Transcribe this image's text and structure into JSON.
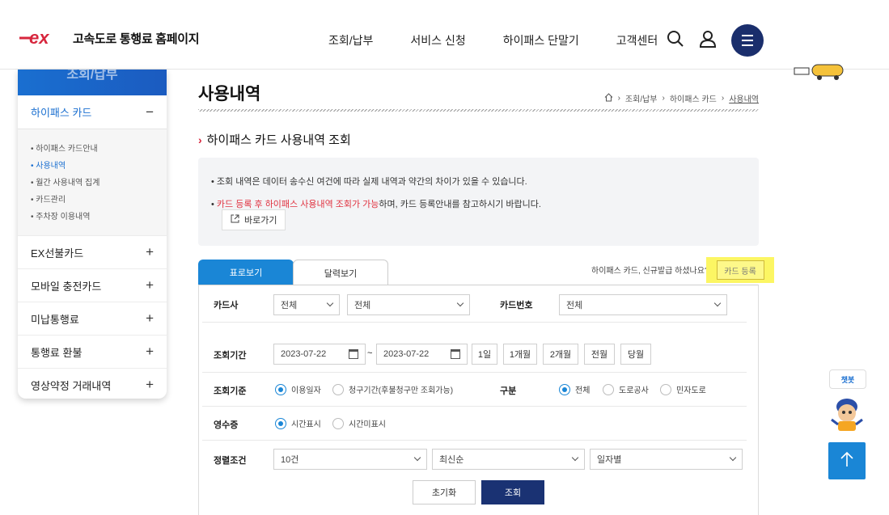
{
  "header": {
    "logo_text": "고속도로 통행료 홈페이지",
    "nav": [
      "조회/납부",
      "서비스 신청",
      "하이패스 단말기",
      "고객센터"
    ]
  },
  "sidebar": {
    "banner": "조회/납부",
    "main": "하이패스 카드",
    "main_toggle": "−",
    "sub": [
      "하이패스 카드안내",
      "사용내역",
      "월간 사용내역 집계",
      "카드관리",
      "주차장 이용내역"
    ],
    "items": [
      "EX선불카드",
      "모바일 충전카드",
      "미납통행료",
      "통행료 환불",
      "영상약정 거래내역"
    ],
    "item_toggle": "+"
  },
  "page": {
    "title": "사용내역",
    "breadcrumb": [
      "조회/납부",
      "하이패스 카드",
      "사용내역"
    ],
    "section_title": "하이패스 카드 사용내역 조회"
  },
  "notice": {
    "line1": "조회 내역은 데이터 송수신 여건에 따라 실제 내역과 약간의 차이가 있을 수 있습니다.",
    "line2_red": "카드 등록 후 하이패스 사용내역 조회가 가능",
    "line2_rest": "하며, 카드 등록안내를 참고하시기 바랍니다.",
    "goto": "바로가기"
  },
  "tabs": [
    "표로보기",
    "달력보기"
  ],
  "ask": "하이패스 카드, 신규발급 하셨나요?",
  "card_reg": "카드 등록",
  "form": {
    "card_company": {
      "label": "카드사",
      "sel1": "전체",
      "sel2": "전체"
    },
    "card_number": {
      "label": "카드번호",
      "sel": "전체"
    },
    "period": {
      "label": "조회기간",
      "from": "2023-07-22",
      "tilde": "~",
      "to": "2023-07-22",
      "buttons": [
        "1일",
        "1개월",
        "2개월",
        "전월",
        "당월"
      ]
    },
    "basis": {
      "label": "조회기준",
      "opt1": "이용일자",
      "opt2": "청구기간(후불청구만 조회가능)"
    },
    "kind": {
      "label": "구분",
      "opt1": "전체",
      "opt2": "도로공사",
      "opt3": "민자도로"
    },
    "receipt": {
      "label": "영수증",
      "opt1": "시간표시",
      "opt2": "시간미표시"
    },
    "sort": {
      "label": "정렬조건",
      "sel1": "10건",
      "sel2": "최신순",
      "sel3": "일자별"
    },
    "reset": "초기화",
    "search": "조회"
  },
  "floating": {
    "chatbot": "챗봇"
  },
  "colors": {
    "primary": "#1a86d6",
    "navy": "#1a3273",
    "highlight": "#fcf663",
    "red": "#e0313f"
  }
}
